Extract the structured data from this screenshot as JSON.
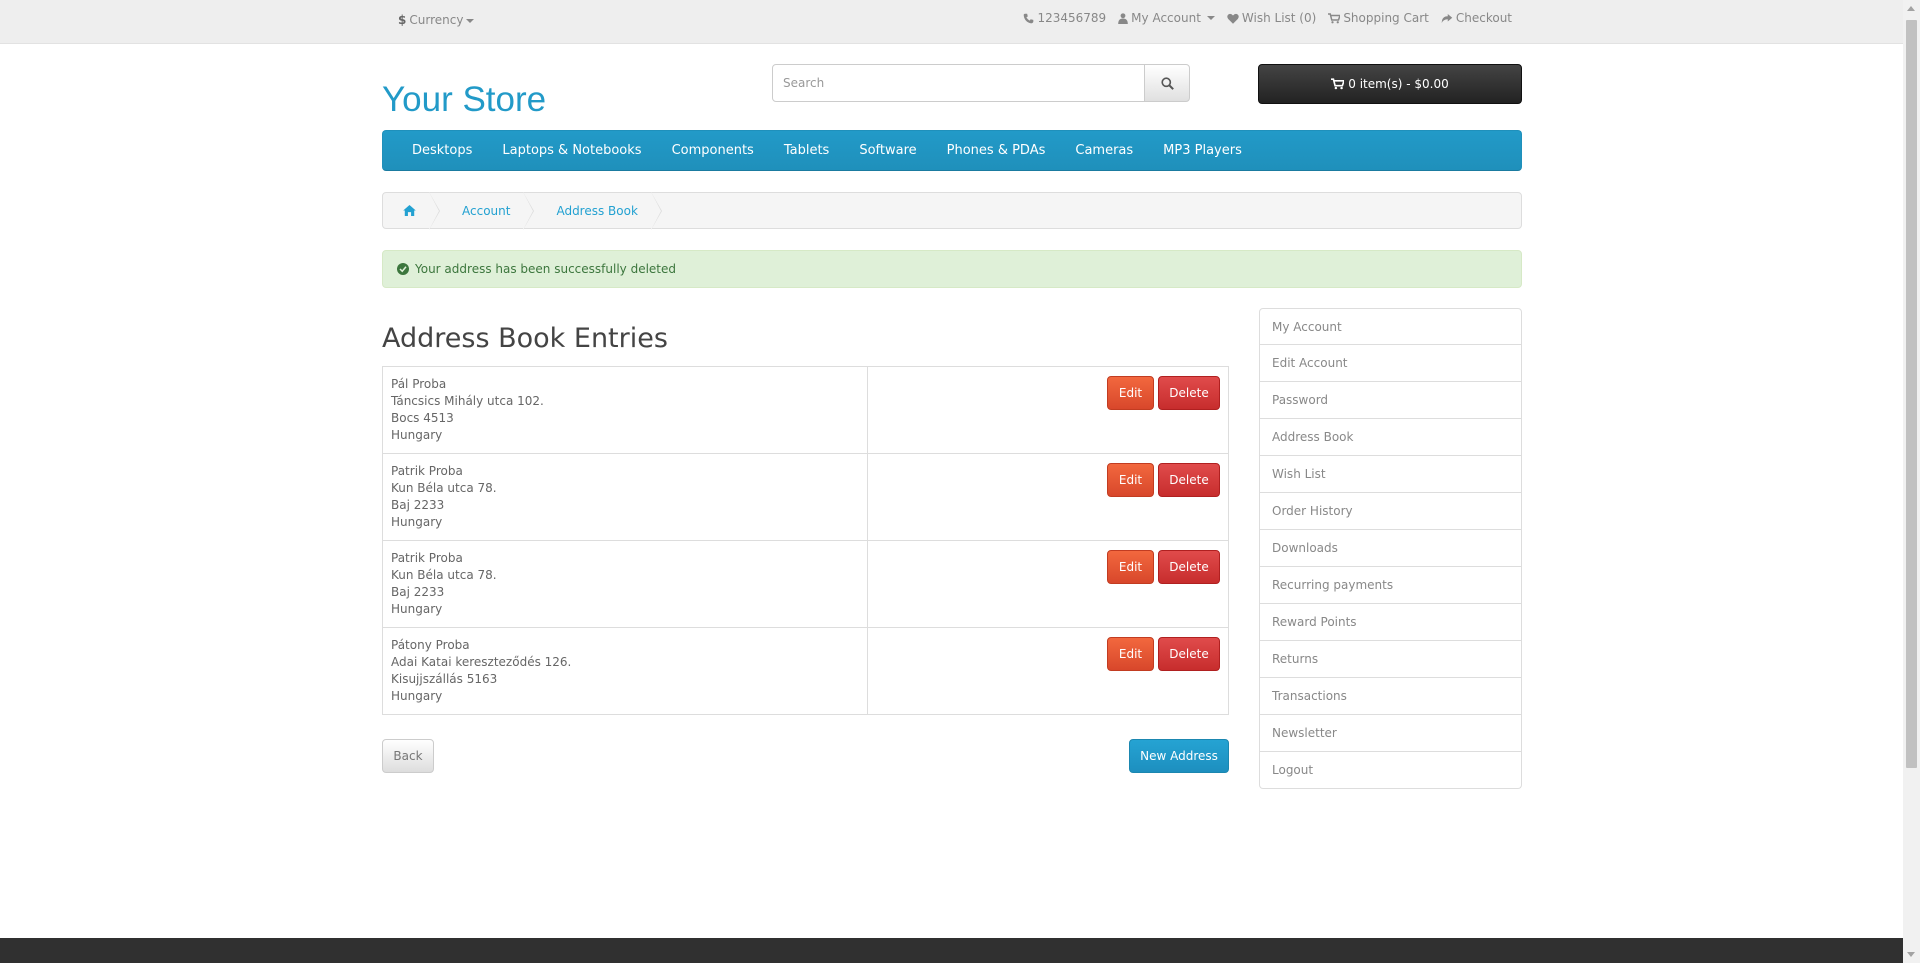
{
  "topbar": {
    "currency_symbol": "$",
    "currency_label": "Currency",
    "phone": "123456789",
    "my_account": "My Account",
    "wish_list": "Wish List (0)",
    "shopping_cart": "Shopping Cart",
    "checkout": "Checkout"
  },
  "header": {
    "logo": "Your Store",
    "search_placeholder": "Search",
    "cart": "0 item(s) - $0.00"
  },
  "menu": [
    "Desktops",
    "Laptops & Notebooks",
    "Components",
    "Tablets",
    "Software",
    "Phones & PDAs",
    "Cameras",
    "MP3 Players"
  ],
  "breadcrumb": [
    "Account",
    "Address Book"
  ],
  "alert": "Your address has been successfully deleted",
  "page_title": "Address Book Entries",
  "addresses": [
    {
      "name": "Pál Proba",
      "street": "Táncsics Mihály utca 102.",
      "city": "Bocs 4513",
      "country": "Hungary"
    },
    {
      "name": "Patrik Proba",
      "street": "Kun Béla utca 78.",
      "city": "Baj 2233",
      "country": "Hungary"
    },
    {
      "name": "Patrik Proba",
      "street": "Kun Béla utca 78.",
      "city": "Baj 2233",
      "country": "Hungary"
    },
    {
      "name": "Pátony Proba",
      "street": "Adai Katai kereszteződés 126.",
      "city": "Kisujjszállás 5163",
      "country": "Hungary"
    }
  ],
  "buttons": {
    "edit": "Edit",
    "delete": "Delete",
    "back": "Back",
    "new_address": "New Address"
  },
  "sidebar": [
    "My Account",
    "Edit Account",
    "Password",
    "Address Book",
    "Wish List",
    "Order History",
    "Downloads",
    "Recurring payments",
    "Reward Points",
    "Returns",
    "Transactions",
    "Newsletter",
    "Logout"
  ]
}
